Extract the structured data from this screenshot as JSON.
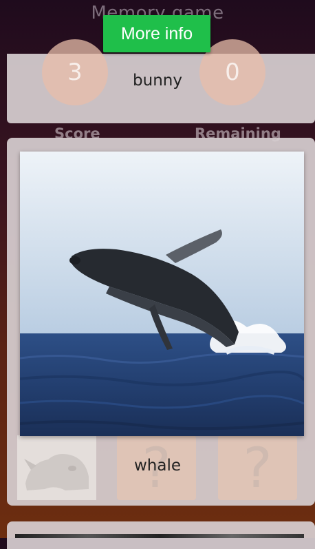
{
  "app": {
    "title": "Memory game"
  },
  "toolbar": {
    "more_info_label": "More info"
  },
  "stats": {
    "score_value": "3",
    "remaining_value": "0",
    "score_label": "Score",
    "remaining_label": "Remaining"
  },
  "current_word": "bunny",
  "card": {
    "image_icon": "whale-photo",
    "word": "whale"
  },
  "tiles": [
    {
      "icon": "rhino-photo",
      "glyph": ""
    },
    {
      "icon": "question-mark-icon",
      "glyph": "?"
    },
    {
      "icon": "question-mark-icon",
      "glyph": "?"
    }
  ],
  "colors": {
    "accent": "#1fbf4a"
  }
}
